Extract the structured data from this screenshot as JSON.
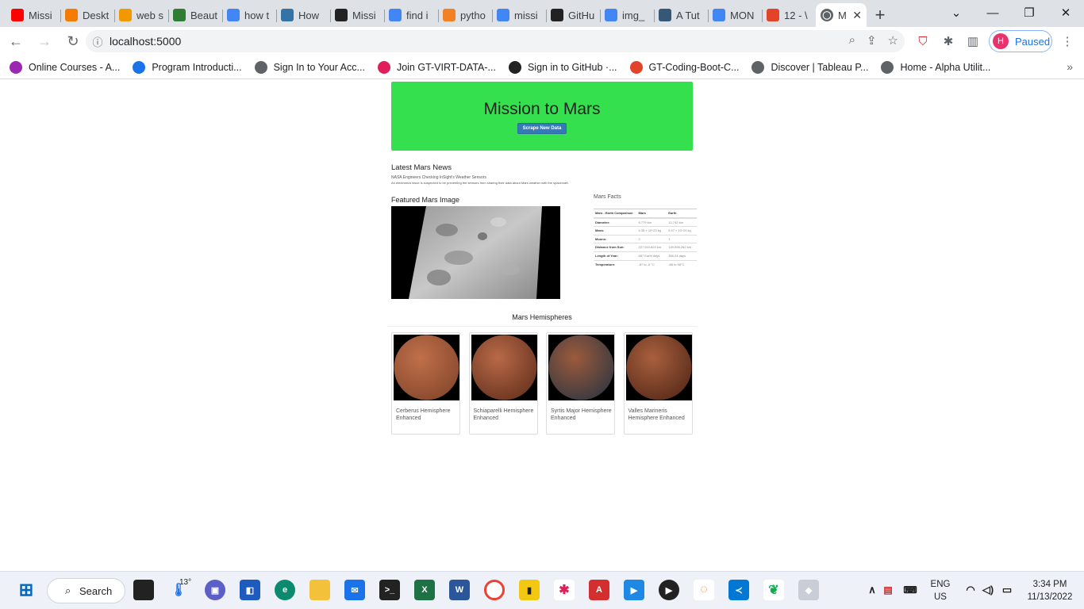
{
  "tabs": [
    {
      "label": "Missi",
      "icon": "youtube-icon",
      "color": "#ff0000"
    },
    {
      "label": "Deskt",
      "icon": "loader-icon",
      "color": "#f57c00"
    },
    {
      "label": "web s",
      "icon": "notebook-icon",
      "color": "#f29900"
    },
    {
      "label": "Beaut",
      "icon": "beautifulsoup-icon",
      "color": "#2e7d32"
    },
    {
      "label": "how t",
      "icon": "google-icon",
      "color": "#4285f4"
    },
    {
      "label": "How",
      "icon": "python-icon",
      "color": "#3572a5"
    },
    {
      "label": "Missi",
      "icon": "github-icon",
      "color": "#222222"
    },
    {
      "label": "find i",
      "icon": "google-icon",
      "color": "#4285f4"
    },
    {
      "label": "pytho",
      "icon": "stackoverflow-icon",
      "color": "#f48024"
    },
    {
      "label": "missi",
      "icon": "google-icon",
      "color": "#4285f4"
    },
    {
      "label": "GitHu",
      "icon": "github-icon",
      "color": "#222222"
    },
    {
      "label": "img_",
      "icon": "google-icon",
      "color": "#4285f4"
    },
    {
      "label": "A Tut",
      "icon": "tds-icon",
      "color": "#355876"
    },
    {
      "label": "MON",
      "icon": "google-icon",
      "color": "#4285f4"
    },
    {
      "label": "12 - \\",
      "icon": "gitlab-icon",
      "color": "#e24329"
    }
  ],
  "active_tab": {
    "label": "M",
    "close": "✕"
  },
  "new_tab": "+",
  "url": "localhost:5000",
  "profile": {
    "initial": "H",
    "status": "Paused"
  },
  "bookmarks": [
    {
      "label": "Online Courses - A...",
      "color": "#9c27b0"
    },
    {
      "label": "Program Introducti...",
      "color": "#1a73e8"
    },
    {
      "label": "Sign In to Your Acc...",
      "color": "#5f6368"
    },
    {
      "label": "Join GT-VIRT-DATA-...",
      "color": "#e01e5a"
    },
    {
      "label": "Sign in to GitHub ·...",
      "color": "#222222"
    },
    {
      "label": "GT-Coding-Boot-C...",
      "color": "#e24329"
    },
    {
      "label": "Discover | Tableau P...",
      "color": "#5f6368"
    },
    {
      "label": "Home - Alpha Utilit...",
      "color": "#5f6368"
    }
  ],
  "page": {
    "title": "Mission to Mars",
    "scrape_button": "Scrape New Data",
    "news_heading": "Latest Mars News",
    "news_title": "NASA Engineers Checking InSight's Weather Sensors",
    "news_paragraph": "An electronics issue is suspected to be preventing the sensors from sharing their data about Mars weather with the spacecraft.",
    "featured_heading": "Featured Mars Image",
    "facts_heading": "Mars Facts",
    "facts": [
      [
        "Mars - Earth Comparison",
        "Mars",
        "Earth"
      ],
      [
        "Diameter:",
        "6,779 km",
        "12,742 km"
      ],
      [
        "Mass:",
        "6.39 × 10^23 kg",
        "5.97 × 10^24 kg"
      ],
      [
        "Moons:",
        "2",
        "1"
      ],
      [
        "Distance from Sun:",
        "227,943,824 km",
        "149,598,262 km"
      ],
      [
        "Length of Year:",
        "687 Earth days",
        "365.24 days"
      ],
      [
        "Temperature:",
        "-87 to -5 °C",
        "-88 to 58°C"
      ]
    ],
    "hemispheres_heading": "Mars Hemispheres",
    "hemispheres": [
      {
        "title": "Cerberus Hemisphere Enhanced"
      },
      {
        "title": "Schiaparelli Hemisphere Enhanced"
      },
      {
        "title": "Syrtis Major Hemisphere Enhanced"
      },
      {
        "title": "Valles Marineris Hemisphere Enhanced"
      }
    ]
  },
  "taskbar": {
    "search_label": "Search",
    "weather": "13°",
    "lang_top": "ENG",
    "lang_bottom": "US",
    "time": "3:34 PM",
    "date": "11/13/2022"
  }
}
